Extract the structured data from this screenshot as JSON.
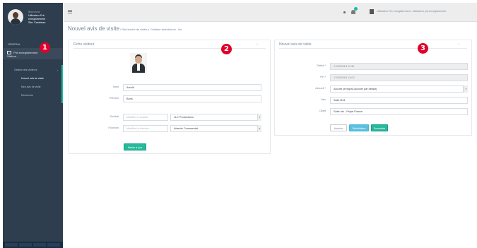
{
  "sidebar": {
    "welcome": "Bienvenue",
    "user_line1": "Utilisateur Pré-",
    "user_line2": "enregistrement",
    "user_line3": "Site: Castelnau",
    "section_title": "GÉNÉRAL",
    "main_item_label": "Pré-enregistrement",
    "main_item_label2": "Visiteur",
    "sub_group_label": "Gestion des visiteurs",
    "items": [
      {
        "label": "Nouvel avis de visite"
      },
      {
        "label": "Mes avis de visite"
      },
      {
        "label": "Recherche"
      }
    ]
  },
  "topbar": {
    "user_name": "Utilisateur Pré-enregistrement - Utilisateur pré-enregistrement"
  },
  "page": {
    "title": "Nouvel avis de visite",
    "breadcrumb": " / Recherche de visiteur / Visiteur sélectionné : Ne"
  },
  "badges": [
    "1",
    "2",
    "3"
  ],
  "visitor_panel": {
    "title": "Fiche visiteur",
    "nom_label": "Nom",
    "nom_value": "Arnold",
    "prenom_label": "Prénom",
    "prenom_value": "Boris",
    "societe_label": "Société",
    "societe_placeholder": "Modifier la société",
    "societe_value": "JLC Productions",
    "fonction_label": "Fonction",
    "fonction_placeholder": "Modifier la fonction",
    "fonction_value": "Attaché Commercial",
    "update_button": "Mettre à jour"
  },
  "visit_panel": {
    "title": "Nouvel avis de visite",
    "debut_label": "Début *",
    "debut_value": "17/09/2018 11:30",
    "fin_label": "Fin *",
    "fin_value": "17/09/2018 13:00",
    "accueil_label": "Accueil *",
    "accueil_value": "Accueil principal (Accueil par défaut)",
    "lieu_label": "Lieu",
    "lieu_value": "Salle B13",
    "objet_label": "Objet",
    "objet_value": "Suite rdv - Projet France",
    "cancel_button": "Annuler",
    "reset_button": "Réinitialiser",
    "submit_button": "Soumettre"
  },
  "colors": {
    "sidebar_bg": "#2e3e4f",
    "accent_green": "#26b99a",
    "badge_red": "#e0002a"
  }
}
